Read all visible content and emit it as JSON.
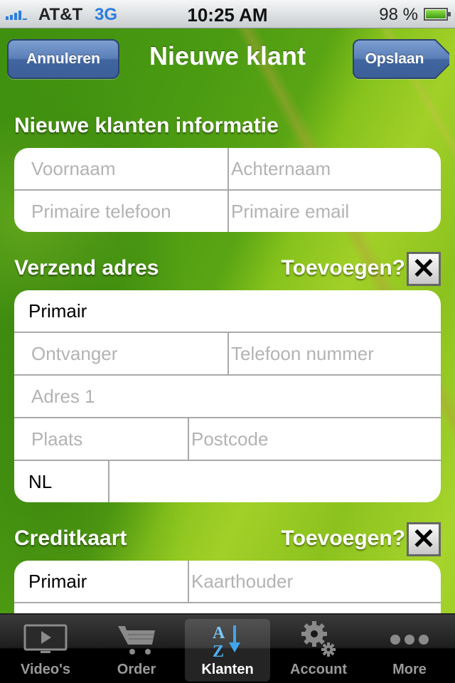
{
  "status_bar": {
    "carrier": "AT&T",
    "network": "3G",
    "time": "10:25 AM",
    "battery_percent": "98 %",
    "battery_level": 0.98,
    "signal_bars": 4
  },
  "nav": {
    "title": "Nieuwe klant",
    "cancel_label": "Annuleren",
    "save_label": "Opslaan"
  },
  "customer_info": {
    "title": "Nieuwe klanten informatie",
    "fields": {
      "first_name": {
        "placeholder": "Voornaam",
        "value": ""
      },
      "last_name": {
        "placeholder": "Achternaam",
        "value": ""
      },
      "phone": {
        "placeholder": "Primaire telefoon",
        "value": ""
      },
      "email": {
        "placeholder": "Primaire email",
        "value": ""
      }
    }
  },
  "shipping": {
    "title": "Verzend adres",
    "add_label": "Toevoegen?",
    "add_checked": true,
    "checkbox_glyph": "✕",
    "type_value": "Primair",
    "fields": {
      "recipient": {
        "placeholder": "Ontvanger",
        "value": ""
      },
      "phone": {
        "placeholder": "Telefoon nummer",
        "value": ""
      },
      "address1": {
        "placeholder": "Adres 1",
        "value": ""
      },
      "city": {
        "placeholder": "Plaats",
        "value": ""
      },
      "postcode": {
        "placeholder": "Postcode",
        "value": ""
      },
      "country_value": "NL",
      "country_extra": {
        "placeholder": "",
        "value": ""
      }
    }
  },
  "credit_card": {
    "title": "Creditkaart",
    "add_label": "Toevoegen?",
    "add_checked": true,
    "checkbox_glyph": "✕",
    "type_value": "Primair",
    "fields": {
      "cardholder": {
        "placeholder": "Kaarthouder",
        "value": ""
      }
    }
  },
  "tab_bar": {
    "items": [
      {
        "label": "Video's",
        "icon": "tv-play-icon",
        "active": false
      },
      {
        "label": "Order",
        "icon": "shopping-cart-icon",
        "active": false
      },
      {
        "label": "Klanten",
        "icon": "az-sort-icon",
        "active": true
      },
      {
        "label": "Account",
        "icon": "gears-icon",
        "active": false
      },
      {
        "label": "More",
        "icon": "more-dots-icon",
        "active": false
      }
    ]
  }
}
